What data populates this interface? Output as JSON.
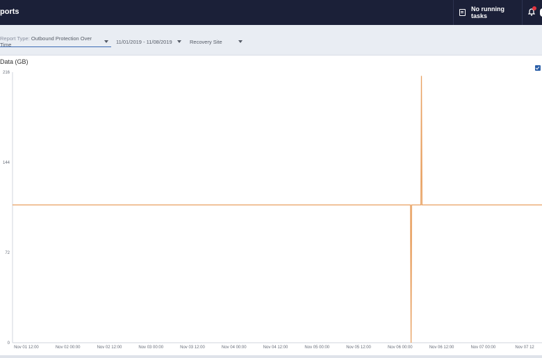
{
  "header": {
    "title": "ports",
    "tasks_label": "No running tasks",
    "tasks_icon": "tasks-list-icon",
    "bell_icon": "notification-bell-icon"
  },
  "filters": {
    "report_type_prefix": "Report Type:",
    "report_type_value": "Outbound Protection Over Time",
    "date_range": "11/01/2019 - 11/08/2019",
    "site": "Recovery Site"
  },
  "colors": {
    "header_bg": "#1b2038",
    "series": "#e8a060",
    "accent": "#2b5fa8"
  },
  "chart_data": {
    "type": "line",
    "ylabel": "Data (GB)",
    "ylim": [
      0,
      216
    ],
    "yticks": [
      "216",
      "144",
      "72",
      "0"
    ],
    "ytick_values": [
      216,
      144,
      72,
      0
    ],
    "xtick_labels": [
      "Nov 01 12:00",
      "Nov 02 00:00",
      "Nov 02 12:00",
      "Nov 03 00:00",
      "Nov 03 12:00",
      "Nov 04 00:00",
      "Nov 04 12:00",
      "Nov 05 00:00",
      "Nov 05 12:00",
      "Nov 06 00:00",
      "Nov 06 12:00",
      "Nov 07 00:00",
      "Nov 07 12"
    ],
    "xlim": [
      "2019-11-01 08:00",
      "2019-11-07 17:00"
    ],
    "xtick_values": [
      "2019-11-01 12:00",
      "2019-11-02 00:00",
      "2019-11-02 12:00",
      "2019-11-03 00:00",
      "2019-11-03 12:00",
      "2019-11-04 00:00",
      "2019-11-04 12:00",
      "2019-11-05 00:00",
      "2019-11-05 12:00",
      "2019-11-06 00:00",
      "2019-11-06 12:00",
      "2019-11-07 00:00",
      "2019-11-07 12:00"
    ],
    "legend_checked": true,
    "series": [
      {
        "x": [
          "2019-11-01 08:00",
          "2019-11-06 03:00",
          "2019-11-06 03:10",
          "2019-11-06 03:20",
          "2019-11-06 03:30",
          "2019-11-06 06:00",
          "2019-11-06 06:10",
          "2019-11-06 06:20",
          "2019-11-07 17:00"
        ],
        "values": [
          110,
          110,
          0,
          110,
          110,
          110,
          213,
          110,
          110
        ]
      }
    ]
  }
}
